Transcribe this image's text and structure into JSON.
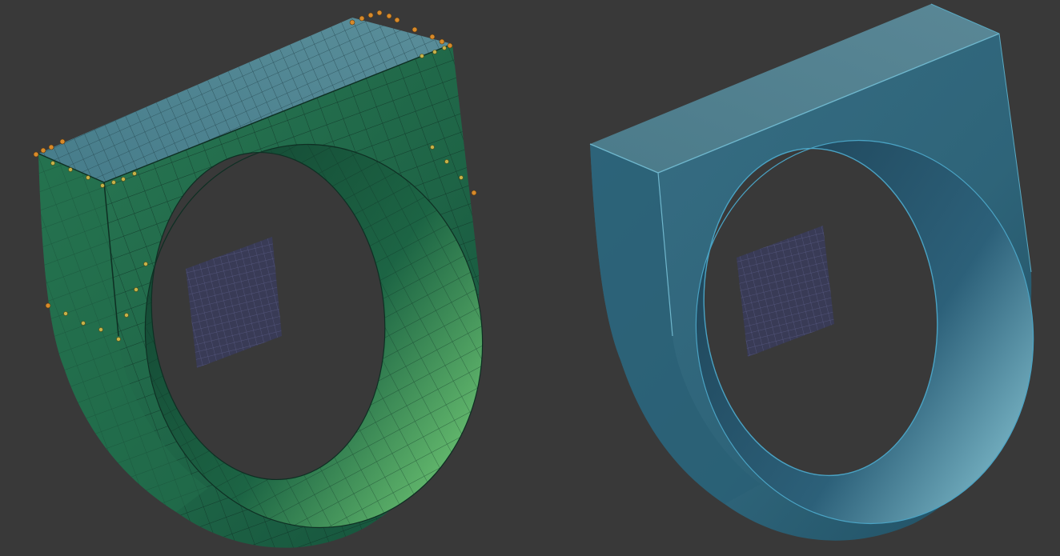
{
  "viewport": {
    "background": "#393939"
  },
  "models": [
    {
      "name": "ring-wireframe-model",
      "display_mode": "wireframe-with-control-points",
      "body_color": "#1f6b4a",
      "top_color": "#4e8593",
      "wire_color": "#0f2f24",
      "inner_highlight": "#5fb36a",
      "control_point_color": "#d88a2a"
    },
    {
      "name": "ring-smooth-model",
      "display_mode": "smooth-shaded",
      "body_color": "#2f6a82",
      "top_color": "#4f7e8c",
      "edge_highlight": "#4aa3c4"
    }
  ],
  "reference_planes": [
    {
      "name": "reference-grid-plane-left",
      "color": "#3a3c5c"
    },
    {
      "name": "reference-grid-plane-right",
      "color": "#3a3c5c"
    }
  ]
}
